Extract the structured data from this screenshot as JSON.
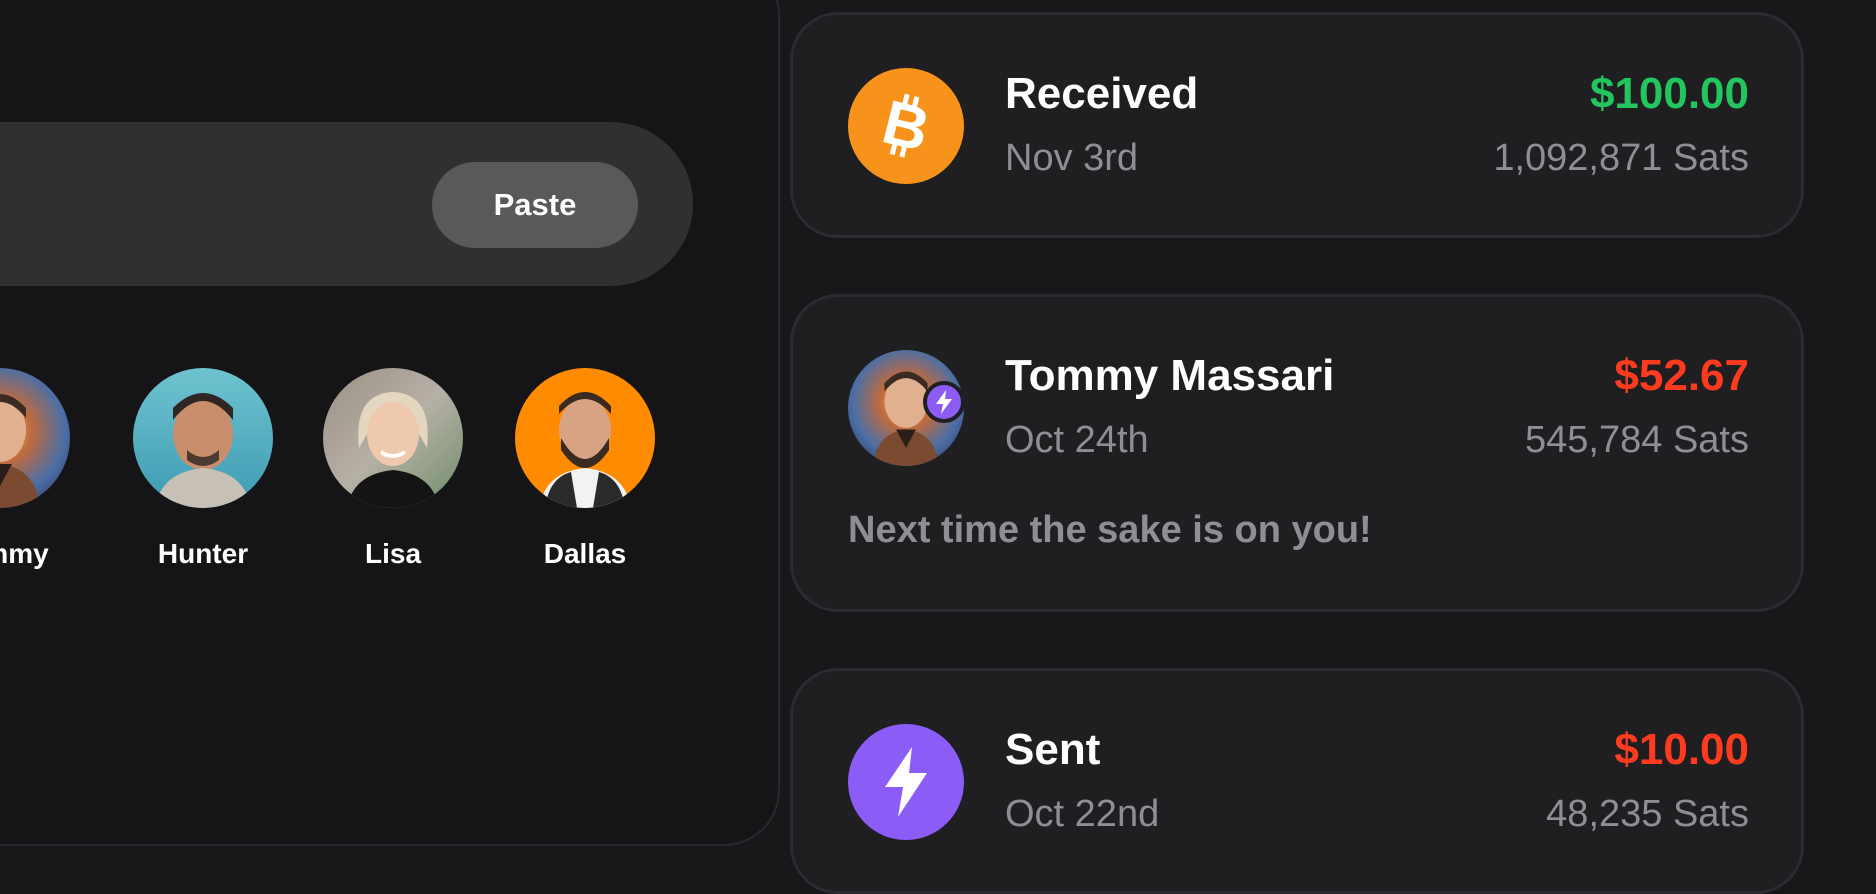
{
  "input": {
    "paste_label": "Paste"
  },
  "contacts": [
    {
      "name": "Tommy",
      "icon": "avatar-tommy"
    },
    {
      "name": "Hunter",
      "icon": "avatar-hunter"
    },
    {
      "name": "Lisa",
      "icon": "avatar-lisa"
    },
    {
      "name": "Dallas",
      "icon": "avatar-dallas"
    }
  ],
  "transactions": [
    {
      "title": "Received",
      "date": "Nov 3rd",
      "amount": "$100.00",
      "sats": "1,092,871 Sats",
      "direction": "in",
      "icon": "bitcoin-icon"
    },
    {
      "title": "Tommy Massari",
      "date": "Oct 24th",
      "amount": "$52.67",
      "sats": "545,784 Sats",
      "memo": "Next time the sake is on you!",
      "direction": "out",
      "icon": "avatar-tommy"
    },
    {
      "title": "Sent",
      "date": "Oct 22nd",
      "amount": "$10.00",
      "sats": "48,235 Sats",
      "direction": "out",
      "icon": "lightning-icon"
    }
  ],
  "colors": {
    "received": "#22c55e",
    "sent": "#ff3b1f",
    "bitcoin": "#f7931a",
    "lightning": "#8b5cf6"
  }
}
